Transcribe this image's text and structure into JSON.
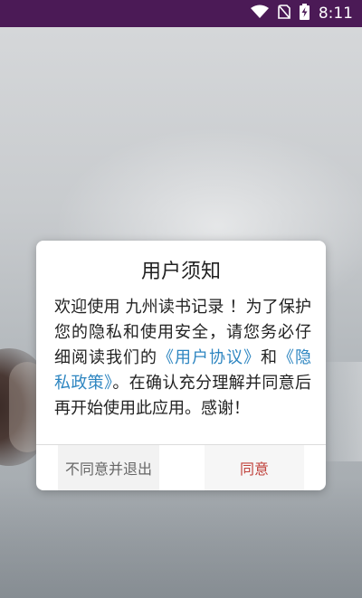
{
  "status_bar": {
    "time": "8:11",
    "icons": [
      "wifi-icon",
      "no-sim-icon",
      "battery-charging-icon"
    ],
    "background": "#4b1a56"
  },
  "dialog": {
    "title": "用户须知",
    "body_part1": "欢迎使用 九州读书记录 ！为了保护您的隐私和使用安全，请您务必仔细阅读我们的",
    "user_agreement_link": "《用户协议》",
    "and_text": "和",
    "privacy_policy_link": "《隐私政策》",
    "body_part2": "。在确认充分理解并同意后再开始使用此应用。感谢！",
    "decline_label": "不同意并退出",
    "agree_label": "同意",
    "link_color": "#2e86c1",
    "agree_color": "#c0413b"
  }
}
